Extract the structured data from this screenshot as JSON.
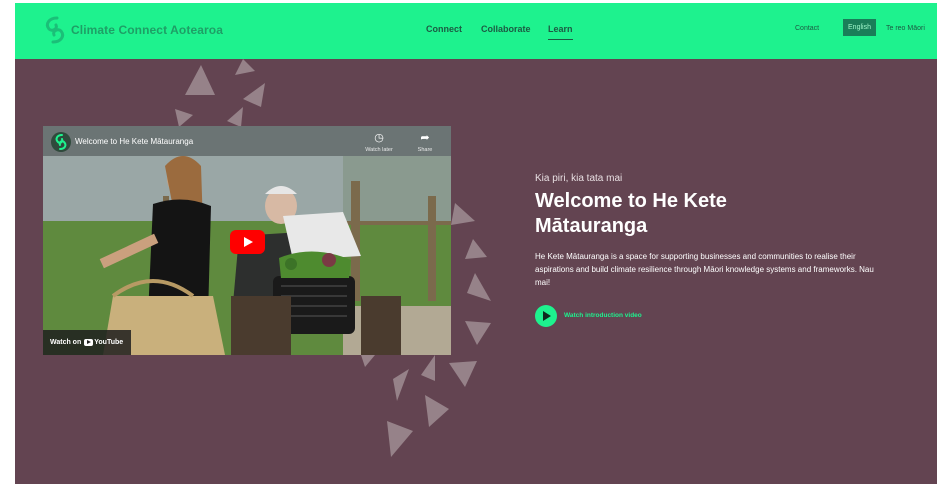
{
  "header": {
    "logo_text": "Climate Connect Aotearoa",
    "nav": [
      {
        "label": "Connect",
        "active": false
      },
      {
        "label": "Collaborate",
        "active": false
      },
      {
        "label": "Learn",
        "active": true
      }
    ],
    "contact": "Contact",
    "lang_active": "English",
    "lang_other": "Te reo Māori"
  },
  "video": {
    "title": "Welcome to He Kete Mātauranga",
    "watch_later": "Watch later",
    "share": "Share",
    "watch_on": "Watch on",
    "youtube": "YouTube"
  },
  "hero": {
    "eyebrow": "Kia piri, kia tata mai",
    "headline": "Welcome to He Kete Mātauranga",
    "description": "He Kete Mātauranga is a space for supporting businesses and communities to realise their aspirations and build climate resilience through Māori knowledge systems and frameworks. Nau mai!",
    "cta": "Watch introduction video"
  },
  "colors": {
    "brand_green": "#1ef28e",
    "background": "#634451",
    "lang_active_bg": "#1a7e59"
  },
  "icons": [
    "logo-icon",
    "clock-icon",
    "share-icon",
    "play-icon",
    "youtube-icon"
  ]
}
